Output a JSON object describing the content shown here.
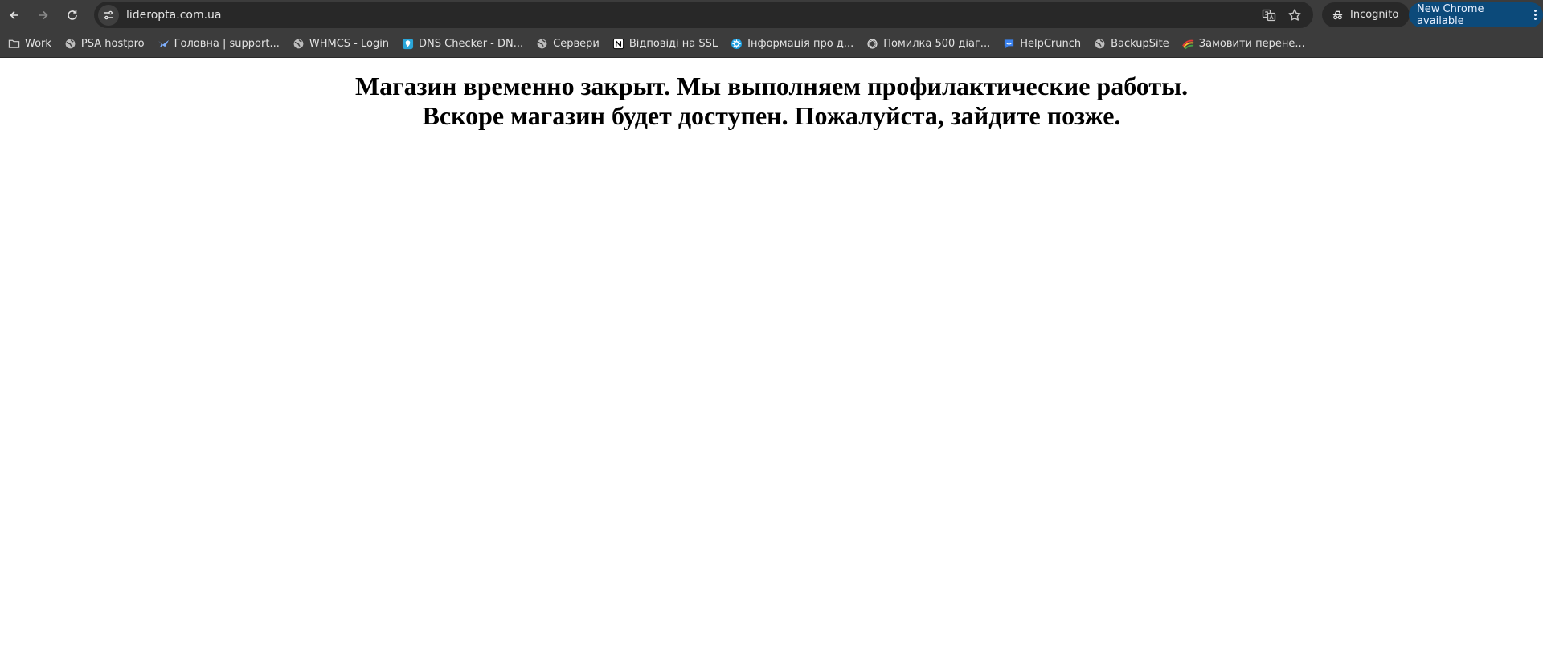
{
  "browser": {
    "url": "lideropta.com.ua",
    "incognito_label": "Incognito",
    "update_label": "New Chrome available"
  },
  "bookmarks": [
    {
      "label": "Work",
      "icon": "folder-icon"
    },
    {
      "label": "PSA hostpro",
      "icon": "globe-icon"
    },
    {
      "label": "Головна | support...",
      "icon": "bird-logo-icon"
    },
    {
      "label": "WHMCS - Login",
      "icon": "globe-icon"
    },
    {
      "label": "DNS Checker - DN...",
      "icon": "dns-checker-icon"
    },
    {
      "label": "Сервери",
      "icon": "globe-icon"
    },
    {
      "label": "Відповіді на SSL",
      "icon": "notion-icon"
    },
    {
      "label": "Інформація про д...",
      "icon": "gear-badge-icon"
    },
    {
      "label": "Помилка 500 діаг...",
      "icon": "openai-icon"
    },
    {
      "label": "HelpCrunch",
      "icon": "chat-bubble-icon"
    },
    {
      "label": "BackupSite",
      "icon": "globe-icon"
    },
    {
      "label": "Замовити перене...",
      "icon": "rainbow-logo-icon"
    }
  ],
  "page": {
    "line1": "Магазин временно закрыт. Мы выполняем профилактические работы.",
    "line2": "Вскоре магазин будет доступен. Пожалуйста, зайдите позже."
  }
}
